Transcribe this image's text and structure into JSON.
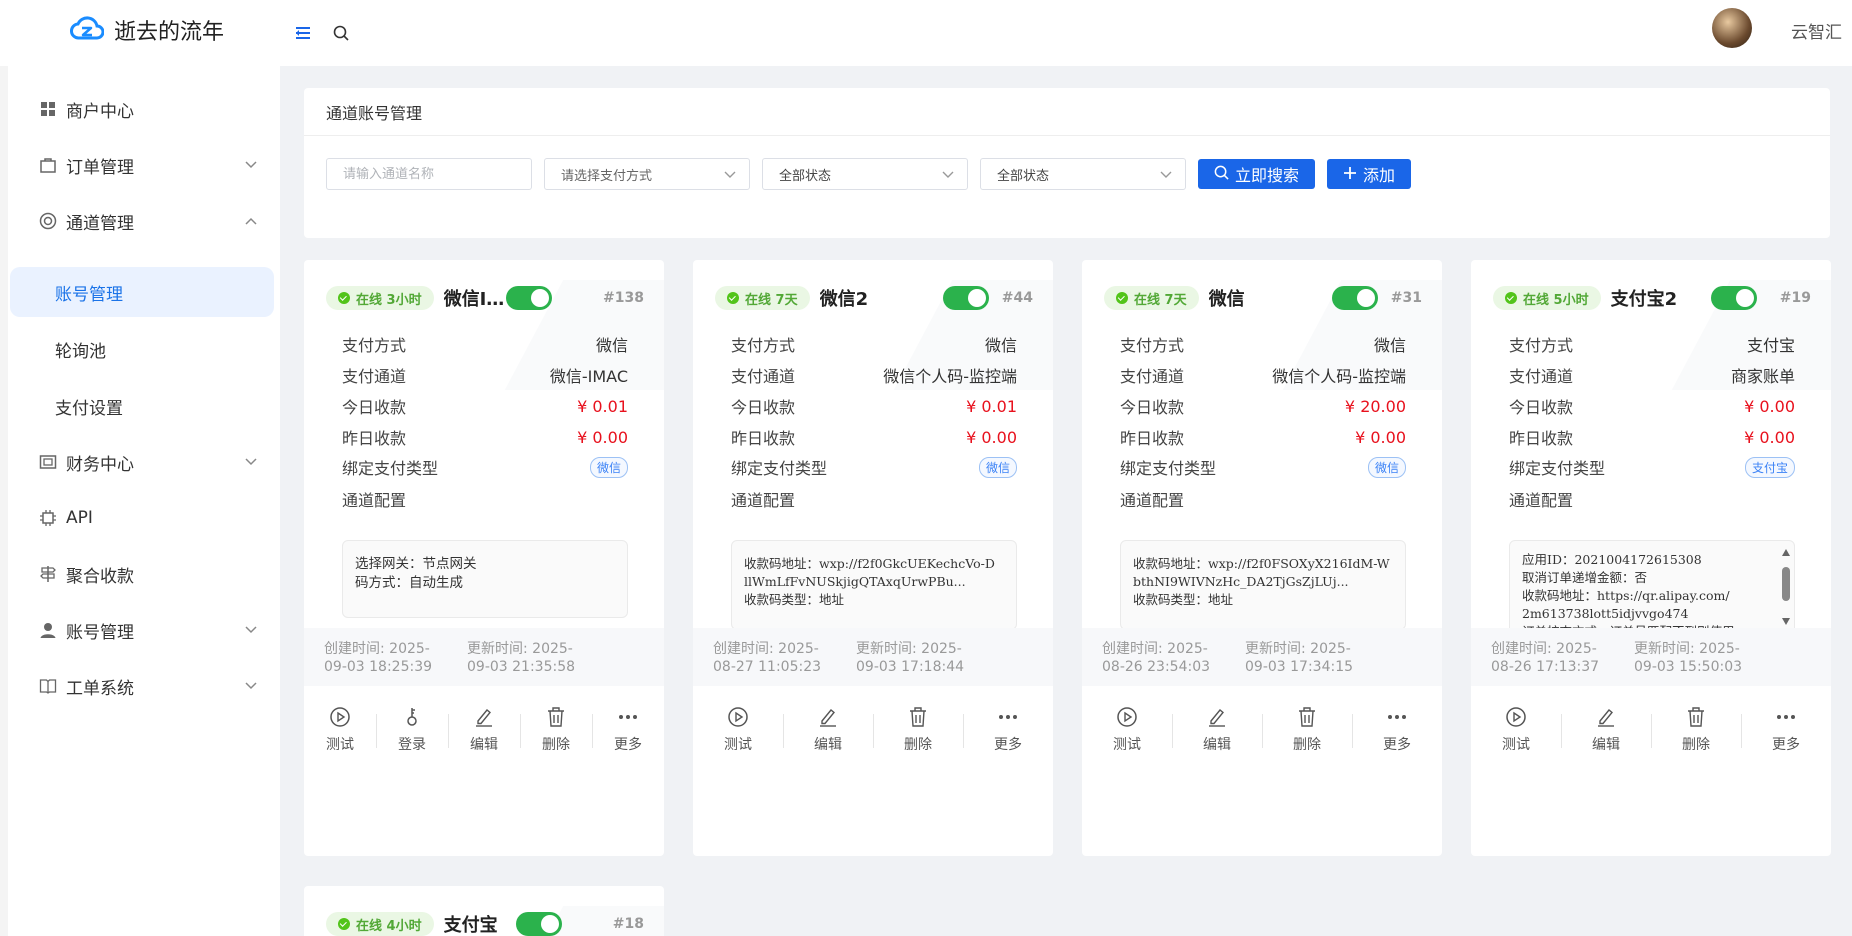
{
  "header": {
    "title": "逝去的流年",
    "user_name": "云智汇"
  },
  "sidebar": {
    "items": [
      {
        "label": "商户中心"
      },
      {
        "label": "订单管理"
      },
      {
        "label": "通道管理"
      },
      {
        "label": "账号管理",
        "sub": true
      },
      {
        "label": "轮询池",
        "sub": true
      },
      {
        "label": "支付设置",
        "sub": true
      },
      {
        "label": "财务中心"
      },
      {
        "label": "API"
      },
      {
        "label": "聚合收款"
      },
      {
        "label": "账号管理"
      },
      {
        "label": "工单系统"
      }
    ]
  },
  "panel": {
    "title": "通道账号管理",
    "search_placeholder": "请输入通道名称",
    "pay_select": "请选择支付方式",
    "status_select_1": "全部状态",
    "status_select_2": "全部状态",
    "search_button": "立即搜索",
    "add_button": "添加"
  },
  "labels": {
    "pay_method": "支付方式",
    "pay_channel": "支付通道",
    "today": "今日收款",
    "yesterday": "昨日收款",
    "bind_type": "绑定支付类型",
    "config": "通道配置"
  },
  "cards": [
    {
      "status": "在线 3小时",
      "name": "微信IMAC",
      "id": "#138",
      "pay_method": "微信",
      "pay_channel": "微信-IMAC",
      "today": "¥ 0.01",
      "yesterday": "¥ 0.00",
      "bind_type": "微信",
      "config": [
        "选择网关：节点网关",
        "码方式：自动生成"
      ],
      "created": "创建时间: 2025-09-03 18:25:39",
      "updated": "更新时间: 2025-09-03 21:35:58",
      "actions": [
        "测试",
        "登录",
        "编辑",
        "删除",
        "更多"
      ]
    },
    {
      "status": "在线 7天",
      "name": "微信2",
      "id": "#44",
      "pay_method": "微信",
      "pay_channel": "微信个人码-监控端",
      "today": "¥ 0.01",
      "yesterday": "¥ 0.00",
      "bind_type": "微信",
      "config": [
        "收款码地址：wxp://f2f0GkcUEKechcVo-D",
        "llWmLfFvNUSkjigQTAxqUrwPBu...",
        "收款码类型：地址"
      ],
      "created": "创建时间: 2025-08-27 11:05:23",
      "updated": "更新时间: 2025-09-03 17:18:44",
      "actions": [
        "测试",
        "编辑",
        "删除",
        "更多"
      ]
    },
    {
      "status": "在线 7天",
      "name": "微信",
      "id": "#31",
      "pay_method": "微信",
      "pay_channel": "微信个人码-监控端",
      "today": "¥ 20.00",
      "yesterday": "¥ 0.00",
      "bind_type": "微信",
      "config": [
        "收款码地址：wxp://f2f0FSOXyX216IdM-W",
        "bthNI9WIVNzHc_DA2TjGsZjLUj...",
        "收款码类型：地址"
      ],
      "created": "创建时间: 2025-08-26 23:54:03",
      "updated": "更新时间: 2025-09-03 17:34:15",
      "actions": [
        "测试",
        "编辑",
        "删除",
        "更多"
      ]
    },
    {
      "status": "在线 5小时",
      "name": "支付宝2",
      "id": "#19",
      "pay_method": "支付宝",
      "pay_channel": "商家账单",
      "today": "¥ 0.00",
      "yesterday": "¥ 0.00",
      "bind_type": "支付宝",
      "config": [
        "应用ID：2021004172615308",
        "取消订单递增金额：否",
        "收款码地址：https://qr.alipay.com/",
        "2m613738lott5idjvvgo474",
        "订单核查方式：订单号匹配不到则使用"
      ],
      "created": "创建时间: 2025-08-26 17:13:37",
      "updated": "更新时间: 2025-09-03 15:50:03",
      "actions": [
        "测试",
        "编辑",
        "删除",
        "更多"
      ]
    },
    {
      "status": "在线 4小时",
      "name": "支付宝",
      "id": "#18"
    }
  ],
  "colors": {
    "accent": "#1a66e8",
    "online": "#52c41a",
    "money": "#e8111d"
  }
}
